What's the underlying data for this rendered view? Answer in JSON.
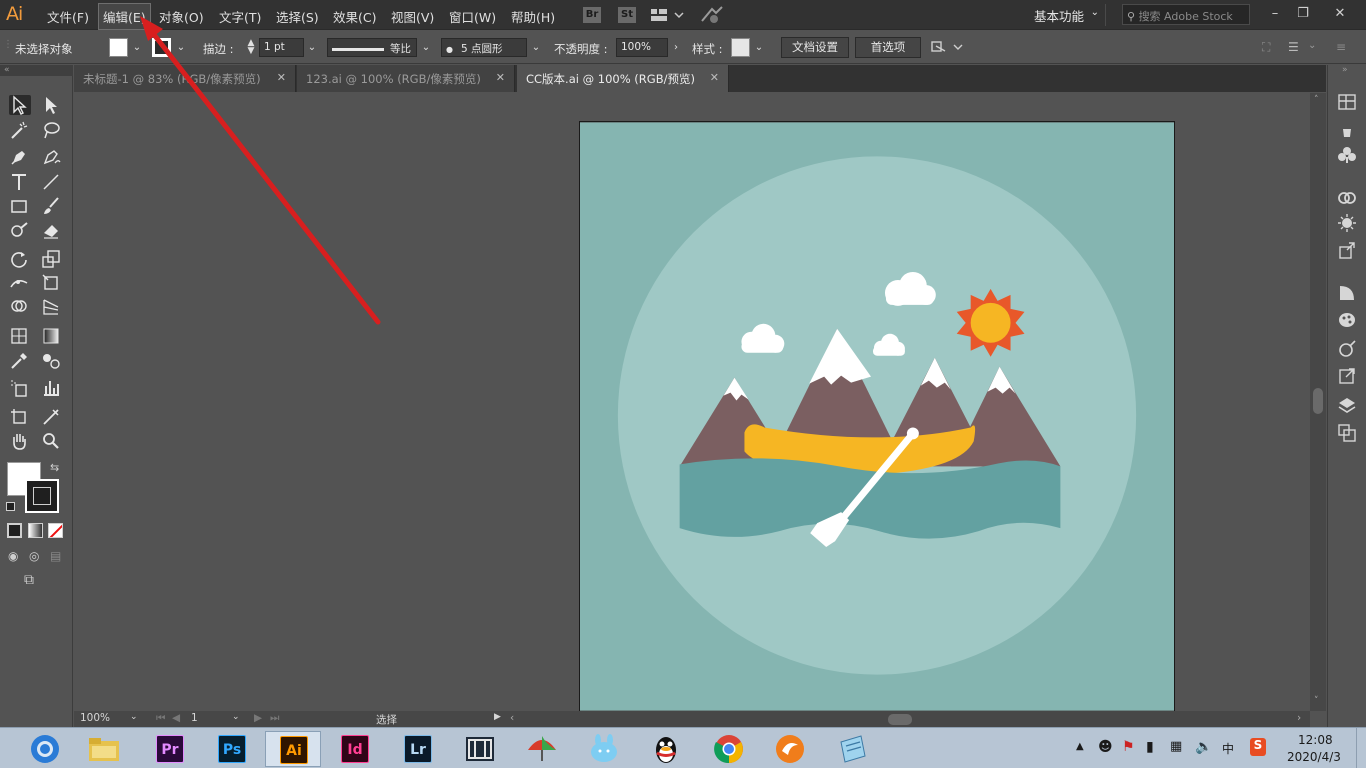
{
  "app": {
    "logo": "Ai"
  },
  "menu": [
    {
      "label": "文件(F)"
    },
    {
      "label": "编辑(E)"
    },
    {
      "label": "对象(O)"
    },
    {
      "label": "文字(T)"
    },
    {
      "label": "选择(S)"
    },
    {
      "label": "效果(C)"
    },
    {
      "label": "视图(V)"
    },
    {
      "label": "窗口(W)"
    },
    {
      "label": "帮助(H)"
    }
  ],
  "bridge": {
    "br": "Br",
    "st": "St"
  },
  "workspace": {
    "label": "基本功能"
  },
  "stock_search": {
    "placeholder": "搜索 Adobe Stock"
  },
  "controlbar": {
    "selection_status": "未选择对象",
    "stroke_label": "描边 :",
    "stroke_weight": "1 pt",
    "stroke_profile": "等比",
    "brush_label": "5 点圆形",
    "opacity_label": "不透明度 :",
    "opacity_value": "100%",
    "style_label": "样式 :",
    "doc_setup": "文档设置",
    "preferences": "首选项"
  },
  "tabs": [
    {
      "label": "未标题-1 @ 83% (RGB/像素预览)"
    },
    {
      "label": "123.ai @ 100% (RGB/像素预览)"
    },
    {
      "label": "CC版本.ai @ 100% (RGB/预览)"
    }
  ],
  "statusbar": {
    "zoom": "100%",
    "artboard_index": "1",
    "tool_status": "选择"
  },
  "taskbar": {
    "premiere": "Pr",
    "photoshop": "Ps",
    "illustrator": "Ai",
    "indesign": "Id",
    "lightroom": "Lr",
    "clock_time": "12:08",
    "clock_date": "2020/4/3",
    "ime": "中"
  },
  "colors": {
    "artboard_bg": "#85b5b1",
    "circle": "#9fc8c5",
    "mountain": "#7b5f61",
    "snow": "#ffffff",
    "canoe": "#f6b623",
    "water": "#63a1a1",
    "sun": "#f6b623",
    "sun_rays": "#e8582a",
    "arrow": "#d81f1f"
  }
}
